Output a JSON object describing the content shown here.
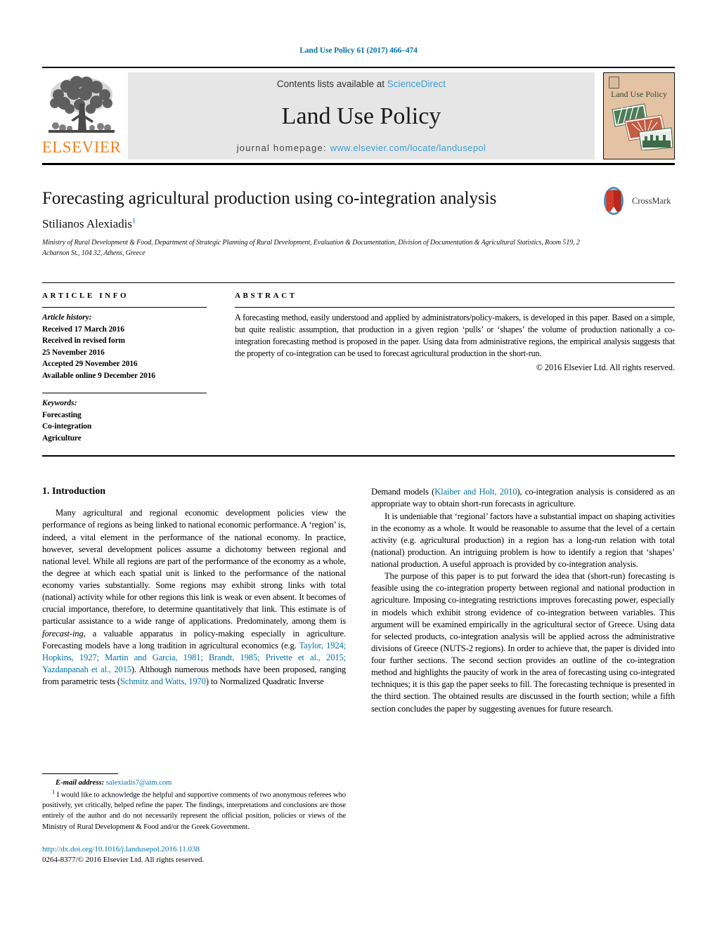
{
  "running_head": "Land Use Policy 61 (2017) 466–474",
  "colors": {
    "link_blue": "#0571a6",
    "masthead_link": "#3b9fd1",
    "elsevier_orange": "#f07f1a",
    "masthead_bg": "#e6e6e6",
    "cover_bg": "#e4c3a4",
    "cover_title_green": "#2d4a35"
  },
  "masthead": {
    "contents_prefix": "Contents lists available at",
    "contents_link": "ScienceDirect",
    "journal_name": "Land Use Policy",
    "homepage_prefix": "journal homepage:",
    "homepage_url": "www.elsevier.com/locate/landusepol",
    "publisher_wordmark": "ELSEVIER",
    "cover_title": "Land Use Policy"
  },
  "article": {
    "title": "Forecasting agricultural production using co-integration analysis",
    "author": "Stilianos Alexiadis",
    "author_footnote_marker": "1",
    "affiliation": "Ministry of Rural Development & Food, Department of Strategic Planning of Rural Development, Evaluation & Documentation, Division of Documentation & Agricultural Statistics, Room 519, 2 Acharnon St., 104 32, Athens, Greece",
    "crossmark_label": "CrossMark"
  },
  "article_info": {
    "heading": "ARTICLE INFO",
    "history_label": "Article history:",
    "history": [
      "Received 17 March 2016",
      "Received in revised form",
      "25 November 2016",
      "Accepted 29 November 2016",
      "Available online 9 December 2016"
    ],
    "keywords_label": "Keywords:",
    "keywords": [
      "Forecasting",
      "Co-integration",
      "Agriculture"
    ]
  },
  "abstract": {
    "heading": "ABSTRACT",
    "text": "A forecasting method, easily understood and applied by administrators/policy-makers, is developed in this paper. Based on a simple, but quite realistic assumption, that production in a given region ‘pulls’ or ‘shapes’ the volume of production nationally a co-integration forecasting method is proposed in the paper. Using data from administrative regions, the empirical analysis suggests that the property of co-integration can be used to forecast agricultural production in the short-run.",
    "copyright": "© 2016 Elsevier Ltd. All rights reserved."
  },
  "body": {
    "section_number_title": "1.  Introduction",
    "left_paragraph_1_part_a": "Many agricultural and regional economic development policies view the performance of regions as being linked to national economic performance. A ‘region’ is, indeed, a vital element in the performance of the national economy. In practice, however, several development polices assume a dichotomy between regional and national level. While all regions are part of the performance of the economy as a whole, the degree at which each spatial unit is linked to the performance of the national economy varies substantially. Some regions may exhibit strong links with total (national) activity while for other regions this link is weak or even absent. It becomes of crucial importance, therefore, to determine quantitatively that link. This estimate is of particular assistance to a wide range of applications. Predominately, among them is ",
    "forecasting_italic": "forecast-ing",
    "left_paragraph_1_part_b": ", a valuable apparatus in policy-making especially in agriculture. Forecasting models have a long tradition in agricultural economics (e.g. ",
    "citation_1": "Taylor, 1924; Hopkins, 1927; Martin and Garcia, 1981; Brandt, 1985; Privette et al., 2015; Yazdanpanah et al., 2015",
    "left_paragraph_1_part_c": "). Although numerous methods have been proposed, ranging from parametric tests (",
    "citation_2": "Schmitz and Watts, 1970",
    "left_paragraph_1_part_d": ") to Normalized Quadratic Inverse",
    "right_paragraph_1_part_a": "Demand models (",
    "citation_3": "Klaiber and Holt, 2010",
    "right_paragraph_1_part_b": "), co-integration analysis is considered as an appropriate way to obtain short-run forecasts in agriculture.",
    "right_paragraph_2": "It is undeniable that ‘regional’ factors have a substantial impact on shaping activities in the economy as a whole. It would be reasonable to assume that the level of a certain activity (e.g. agricultural production) in a region has a long-run relation with total (national) production. An intriguing problem is how to identify a region that ‘shapes’ national production. A useful approach is provided by co-integration analysis.",
    "right_paragraph_3": "The purpose of this paper is to put forward the idea that (short-run) forecasting is feasible using the co-integration property between regional and national production in agriculture. Imposing co-integrating restrictions improves forecasting power, especially in models which exhibit strong evidence of co-integration between variables. This argument will be examined empirically in the agricultural sector of Greece. Using data for selected products, co-integration analysis will be applied across the administrative divisions of Greece (NUTS-2 regions). In order to achieve that, the paper is divided into four further sections. The second section provides an outline of the co-integration method and highlights the paucity of work in the area of forecasting using co-integrated techniques; it is this gap the paper seeks to fill. The forecasting technique is presented in the third section. The obtained results are discussed in the fourth section; while a fifth section concludes the paper by suggesting avenues for future research."
  },
  "footnote": {
    "email_label": "E-mail address:",
    "email": "salexiadis7@aim.com",
    "marker": "1",
    "text": "I would like to acknowledge the helpful and supportive comments of two anonymous referees who positively, yet critically, helped refine the paper. The findings, interpretations and conclusions are those entirely of the author and do not necessarily represent the official position, policies or views of the Ministry of Rural Development & Food and/or the Greek Government.",
    "doi": "http://dx.doi.org/10.1016/j.landusepol.2016.11.038",
    "issn_copyright": "0264-8377/© 2016 Elsevier Ltd. All rights reserved."
  }
}
